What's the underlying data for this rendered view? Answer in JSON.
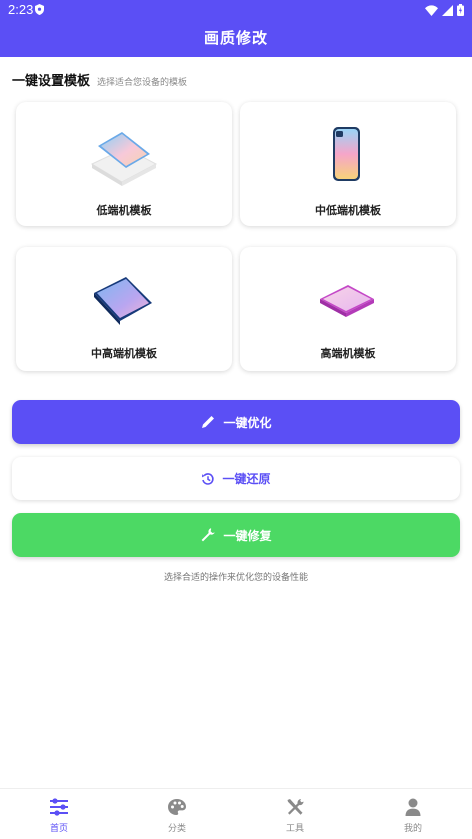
{
  "status_bar": {
    "time": "2:23"
  },
  "app_bar": {
    "title": "画质修改"
  },
  "section": {
    "title": "一键设置模板",
    "subtitle": "选择适合您设备的模板"
  },
  "templates": [
    {
      "label": "低端机模板",
      "icon": "phone-on-stand-icon"
    },
    {
      "label": "中低端机模板",
      "icon": "phone-upright-icon"
    },
    {
      "label": "中高端机模板",
      "icon": "phone-tilted-blue-icon"
    },
    {
      "label": "高端机模板",
      "icon": "phone-tilted-pink-icon"
    }
  ],
  "actions": {
    "optimize_label": "一键优化",
    "restore_label": "一键还原",
    "repair_label": "一键修复"
  },
  "hint": "选择合适的操作来优化您的设备性能",
  "bottom_nav": [
    {
      "label": "首页",
      "icon": "sliders-icon",
      "active": true
    },
    {
      "label": "分类",
      "icon": "palette-icon",
      "active": false
    },
    {
      "label": "工具",
      "icon": "tools-icon",
      "active": false
    },
    {
      "label": "我的",
      "icon": "person-icon",
      "active": false
    }
  ],
  "colors": {
    "primary": "#5b4ff5",
    "success": "#4cd964",
    "background": "#ffffff"
  }
}
